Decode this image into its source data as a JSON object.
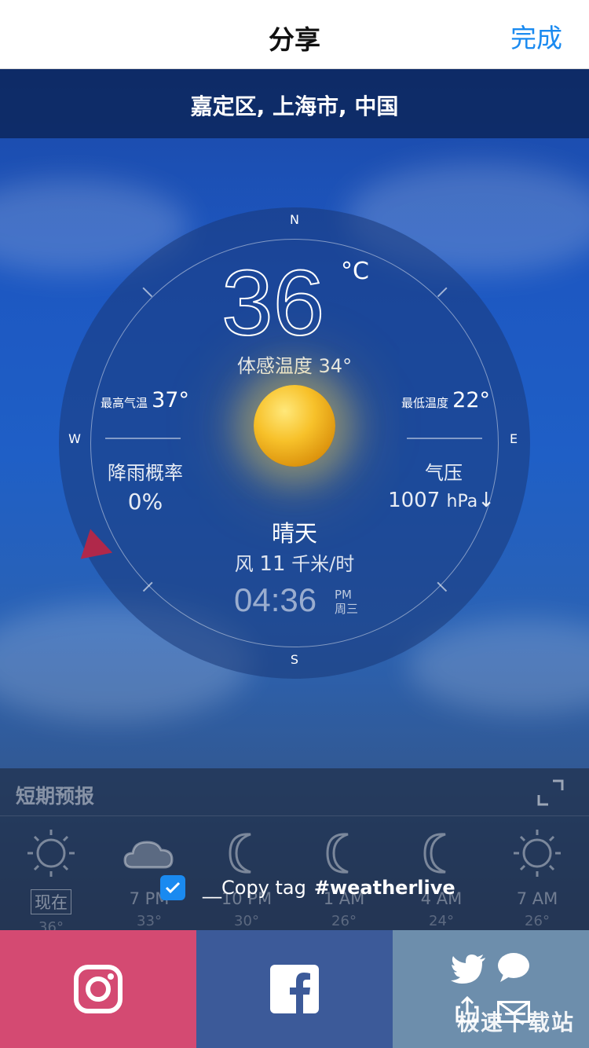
{
  "nav": {
    "title": "分享",
    "done_label": "完成"
  },
  "location": "嘉定区, 上海市, 中国",
  "compass": {
    "n": "N",
    "s": "S",
    "e": "E",
    "w": "W"
  },
  "current": {
    "temp": "36",
    "unit": "°C",
    "feels_like": "体感温度 34°",
    "high_label": "最高气温",
    "high_value": "37°",
    "low_label": "最低温度",
    "low_value": "22°",
    "rain_label": "降雨概率",
    "rain_value": "0%",
    "pressure_label": "气压",
    "pressure_value": "1007",
    "pressure_unit": "hPa",
    "pressure_trend": "↓",
    "condition": "晴天",
    "wind_label": "风",
    "wind_value": "11",
    "wind_unit": "千米/时",
    "time": "04:36",
    "ampm": "PM",
    "weekday": "周三"
  },
  "forecast": {
    "title": "短期预报",
    "items": [
      {
        "time": "现在",
        "icon": "sun-icon",
        "temp": "36°"
      },
      {
        "time": "7 PM",
        "icon": "cloudy-icon",
        "temp": "33°"
      },
      {
        "time": "10 PM",
        "icon": "moon-icon",
        "temp": "30°"
      },
      {
        "time": "1 AM",
        "icon": "moon-icon",
        "temp": "26°"
      },
      {
        "time": "4 AM",
        "icon": "moon-icon",
        "temp": "24°"
      },
      {
        "time": "7 AM",
        "icon": "sun-icon",
        "temp": "26°"
      }
    ]
  },
  "copy_tag": {
    "prefix": "__Copy tag",
    "tag": "#weatherlive",
    "checked": true
  },
  "share": {
    "instagram_icon": "instagram-icon",
    "facebook_icon": "facebook-icon",
    "more_icons": [
      "twitter-icon",
      "message-icon",
      "share-icon",
      "mail-icon"
    ]
  },
  "watermark": "极速下载站",
  "colors": {
    "accent": "#1a8af0",
    "instagram": "#d44a72",
    "facebook": "#3c5a99",
    "more": "#6d8eac"
  }
}
